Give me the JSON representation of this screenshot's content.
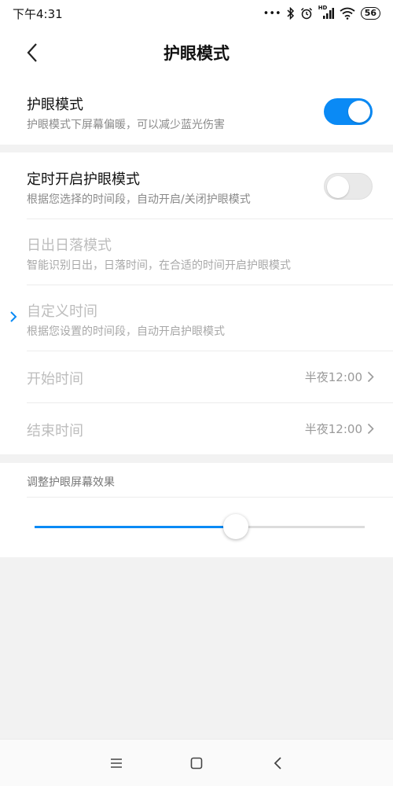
{
  "status_bar": {
    "time": "下午4:31",
    "signal_label": "HD",
    "battery": "56"
  },
  "header": {
    "title": "护眼模式"
  },
  "eye_mode": {
    "title": "护眼模式",
    "subtitle": "护眼模式下屏幕偏暖，可以减少蓝光伤害",
    "enabled": true
  },
  "schedule": {
    "title": "定时开启护眼模式",
    "subtitle": "根据您选择的时间段，自动开启/关闭护眼模式",
    "enabled": false,
    "options": [
      {
        "title": "日出日落模式",
        "subtitle": "智能识别日出，日落时间，在合适的时间开启护眼模式"
      },
      {
        "title": "自定义时间",
        "subtitle": "根据您设置的时间段，自动开启护眼模式"
      }
    ],
    "start": {
      "label": "开始时间",
      "value": "半夜12:00"
    },
    "end": {
      "label": "结束时间",
      "value": "半夜12:00"
    }
  },
  "effect": {
    "label": "调整护眼屏幕效果",
    "level_fraction": 0.61
  },
  "colors": {
    "accent": "#0a8af5",
    "background": "#f2f2f2"
  },
  "icons": [
    "back-arrow-icon",
    "bluetooth-icon",
    "alarm-icon",
    "signal-icon",
    "wifi-icon",
    "battery-icon",
    "menu-icon",
    "home-icon",
    "back-icon"
  ]
}
